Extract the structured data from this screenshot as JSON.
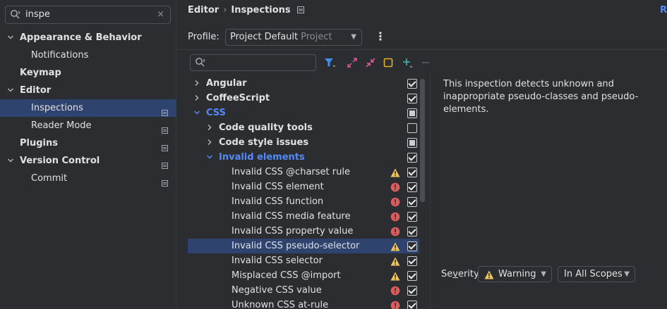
{
  "sidebar": {
    "search": {
      "value": "inspe",
      "clear": "×"
    },
    "items": [
      {
        "label": "Appearance & Behavior",
        "bold": true,
        "expanded": true,
        "level": 0
      },
      {
        "label": "Notifications",
        "bold": false,
        "level": 1
      },
      {
        "label": "Keymap",
        "bold": true,
        "level": 0
      },
      {
        "label": "Editor",
        "bold": true,
        "expanded": true,
        "level": 0
      },
      {
        "label": "Inspections",
        "bold": false,
        "level": 1,
        "selected": true,
        "project_icon": true
      },
      {
        "label": "Reader Mode",
        "bold": false,
        "level": 1,
        "project_icon": true
      },
      {
        "label": "Plugins",
        "bold": true,
        "level": 0,
        "project_icon": true
      },
      {
        "label": "Version Control",
        "bold": true,
        "expanded": true,
        "level": 0,
        "project_icon": true
      },
      {
        "label": "Commit",
        "bold": false,
        "level": 1,
        "project_icon": true
      }
    ]
  },
  "header": {
    "breadcrumb_parent": "Editor",
    "breadcrumb_separator": "›",
    "breadcrumb_current": "Inspections",
    "reset_link": "R"
  },
  "profile": {
    "label": "Profile:",
    "name": "Project Default",
    "scope": "Project",
    "menu_glyph": "⋮"
  },
  "tree": {
    "rows": [
      {
        "label": "Angular",
        "style": "bold",
        "indent": 0,
        "expander": "›",
        "check": "checked"
      },
      {
        "label": "CoffeeScript",
        "style": "bold",
        "indent": 0,
        "expander": "›",
        "check": "checked"
      },
      {
        "label": "CSS",
        "style": "blue",
        "indent": 0,
        "expander": "⌄",
        "check": "partial"
      },
      {
        "label": "Code quality tools",
        "style": "bold",
        "indent": 1,
        "expander": "›",
        "check": "none"
      },
      {
        "label": "Code style issues",
        "style": "bold",
        "indent": 1,
        "expander": "›",
        "check": "partial"
      },
      {
        "label": "Invalid elements",
        "style": "blue",
        "indent": 1,
        "expander": "⌄",
        "check": "checked"
      },
      {
        "label": "Invalid CSS @charset rule",
        "style": "normal",
        "indent": 2,
        "severity": "warning",
        "check": "checked"
      },
      {
        "label": "Invalid CSS element",
        "style": "normal",
        "indent": 2,
        "severity": "error",
        "check": "checked"
      },
      {
        "label": "Invalid CSS function",
        "style": "normal",
        "indent": 2,
        "severity": "error",
        "check": "checked"
      },
      {
        "label": "Invalid CSS media feature",
        "style": "normal",
        "indent": 2,
        "severity": "error",
        "check": "checked"
      },
      {
        "label": "Invalid CSS property value",
        "style": "normal",
        "indent": 2,
        "severity": "error",
        "check": "checked"
      },
      {
        "label": "Invalid CSS pseudo-selector",
        "style": "normal",
        "indent": 2,
        "severity": "warning",
        "check": "checked",
        "selected": true
      },
      {
        "label": "Invalid CSS selector",
        "style": "normal",
        "indent": 2,
        "severity": "warning",
        "check": "checked"
      },
      {
        "label": "Misplaced CSS @import",
        "style": "normal",
        "indent": 2,
        "severity": "warning",
        "check": "checked"
      },
      {
        "label": "Negative CSS value",
        "style": "normal",
        "indent": 2,
        "severity": "error",
        "check": "checked"
      },
      {
        "label": "Unknown CSS at-rule",
        "style": "normal",
        "indent": 2,
        "severity": "error",
        "check": "checked"
      }
    ]
  },
  "description": "This inspection detects unknown and inappropriate pseudo-classes and pseudo-elements.",
  "severity": {
    "label_prefix": "Se",
    "label_underlined": "v",
    "label_suffix": "erity:",
    "value": "Warning",
    "scope": "In All Scopes"
  },
  "colors": {
    "selection": "#2e436e",
    "accent_blue": "#548af7",
    "warning": "#f2c55c",
    "error": "#db5c5c",
    "toolbar_blue": "#3d8ff5",
    "toolbar_pink": "#e0619d",
    "toolbar_orange": "#e6b422",
    "toolbar_teal": "#3fb8a8"
  },
  "icons": [
    "search-icon",
    "clear-icon",
    "chevron-right-icon",
    "chevron-down-icon",
    "project-icon",
    "filter-icon",
    "expand-all-icon",
    "collapse-all-icon",
    "reset-icon",
    "add-icon",
    "remove-icon",
    "warning-icon",
    "error-icon",
    "checkbox-icon",
    "more-options-icon"
  ]
}
